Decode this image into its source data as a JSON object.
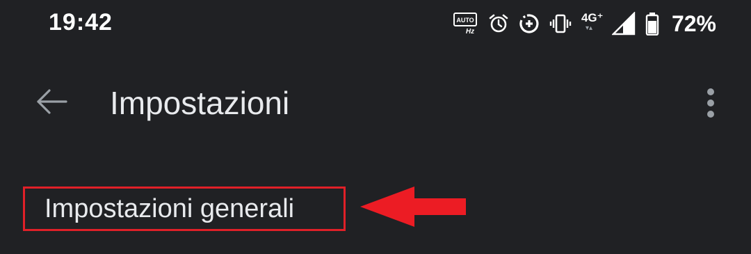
{
  "status_bar": {
    "time": "19:42",
    "icons": [
      "auto-hz-icon",
      "alarm-icon",
      "data-saver-icon",
      "vibrate-icon",
      "network-4g-icon",
      "signal-icon",
      "battery-icon"
    ],
    "network_label": "4G⁺",
    "network_arrows": "▾▴",
    "battery_percent": "72%"
  },
  "app_bar": {
    "title": "Impostazioni",
    "back_icon": "arrow-back-icon",
    "overflow_icon": "more-vert-icon"
  },
  "settings_list": {
    "items": [
      {
        "label": "Impostazioni generali"
      }
    ]
  },
  "annotation": {
    "highlight_color": "#e02028",
    "arrow_color": "#ec1c24"
  },
  "colors": {
    "background": "#202124",
    "text_primary": "#e8eaed"
  }
}
